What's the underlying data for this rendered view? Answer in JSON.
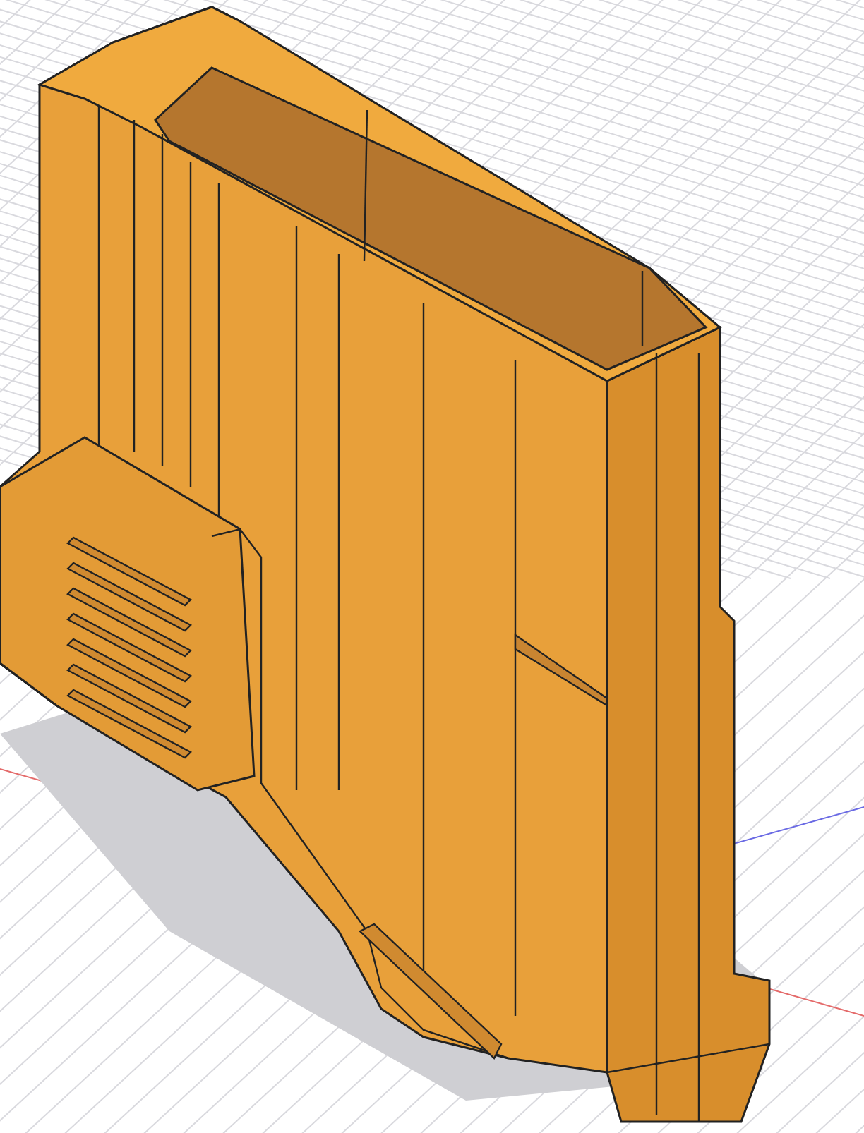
{
  "viewport": {
    "kind": "cad-model",
    "show_grid": true
  }
}
